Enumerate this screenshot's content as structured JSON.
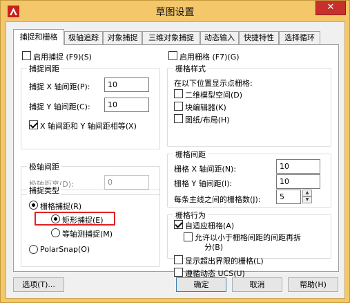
{
  "window": {
    "title": "草图设置",
    "close_glyph": "✕",
    "app_icon": "autocad-logo-icon"
  },
  "tabs": [
    {
      "label": "捕捉和栅格"
    },
    {
      "label": "极轴追踪"
    },
    {
      "label": "对象捕捉"
    },
    {
      "label": "三维对象捕捉"
    },
    {
      "label": "动态输入"
    },
    {
      "label": "快捷特性"
    },
    {
      "label": "选择循环"
    }
  ],
  "snap": {
    "enable_label": "启用捕捉 (F9)(S)",
    "enabled": false,
    "spacing_title": "捕捉间距",
    "x_label": "捕捉 X 轴间距(P):",
    "x_value": "10",
    "y_label": "捕捉 Y 轴间距(C):",
    "y_value": "10",
    "equal_label": "X 轴间距和 Y 轴间距相等(X)",
    "equal_checked": true,
    "polar_title": "极轴间距",
    "polar_label": "极轴距离(D):",
    "polar_value": "0",
    "type_title": "捕捉类型",
    "grid_snap_label": "栅格捕捉(R)",
    "rect_snap_label": "矩形捕捉(E)",
    "iso_snap_label": "等轴测捕捉(M)",
    "polarsnap_label": "PolarSnap(O)"
  },
  "grid": {
    "enable_label": "启用栅格 (F7)(G)",
    "enabled": false,
    "style_title": "栅格样式",
    "style_desc": "在以下位置显示点栅格:",
    "model_space_label": "二维模型空间(D)",
    "block_editor_label": "块编辑器(K)",
    "sheet_layout_label": "图纸/布局(H)",
    "spacing_title": "栅格间距",
    "x_label": "栅格 X 轴间距(N):",
    "x_value": "10",
    "y_label": "栅格 Y 轴间距(I):",
    "y_value": "10",
    "major_label": "每条主线之间的栅格数(J):",
    "major_value": "5",
    "behavior_title": "栅格行为",
    "adaptive_label": "自适应栅格(A)",
    "adaptive_checked": true,
    "subdiv_label_line1": "允许以小于栅格间距的间距再拆",
    "subdiv_label_line2": "分(B)",
    "beyond_limits_label": "显示超出界限的栅格(L)",
    "follow_ucs_label": "遵循动态 UCS(U)"
  },
  "buttons": {
    "options": "选项(T)...",
    "ok": "确定",
    "cancel": "取消",
    "help": "帮助(H)"
  }
}
